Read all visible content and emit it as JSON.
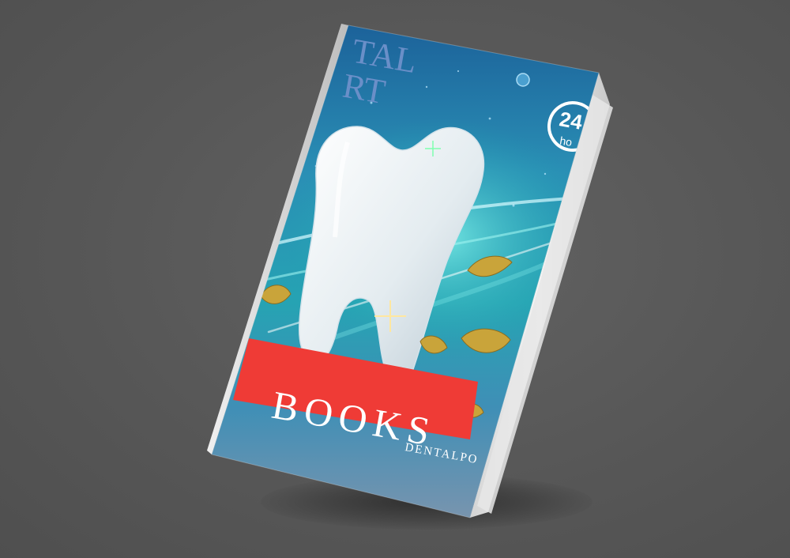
{
  "cover": {
    "masthead_line1": "TAL",
    "masthead_line2": "RT",
    "badge_number": "24",
    "badge_unit": "ho",
    "title": "BOOKS",
    "brand": "DENTALPO"
  },
  "colors": {
    "background": "#585858",
    "cover_top": "#1f6fa0",
    "cover_mid": "#2aa6b8",
    "cover_bottom": "#7f95ad",
    "red_band": "#ef3b36",
    "tooth": "#e9eef2",
    "leaf": "#c9a43a",
    "masthead": "#6a8fc8"
  },
  "icons": {
    "tooth": "tooth-illustration",
    "leaf": "leaf-icon",
    "clock_badge": "24h-badge-icon"
  }
}
